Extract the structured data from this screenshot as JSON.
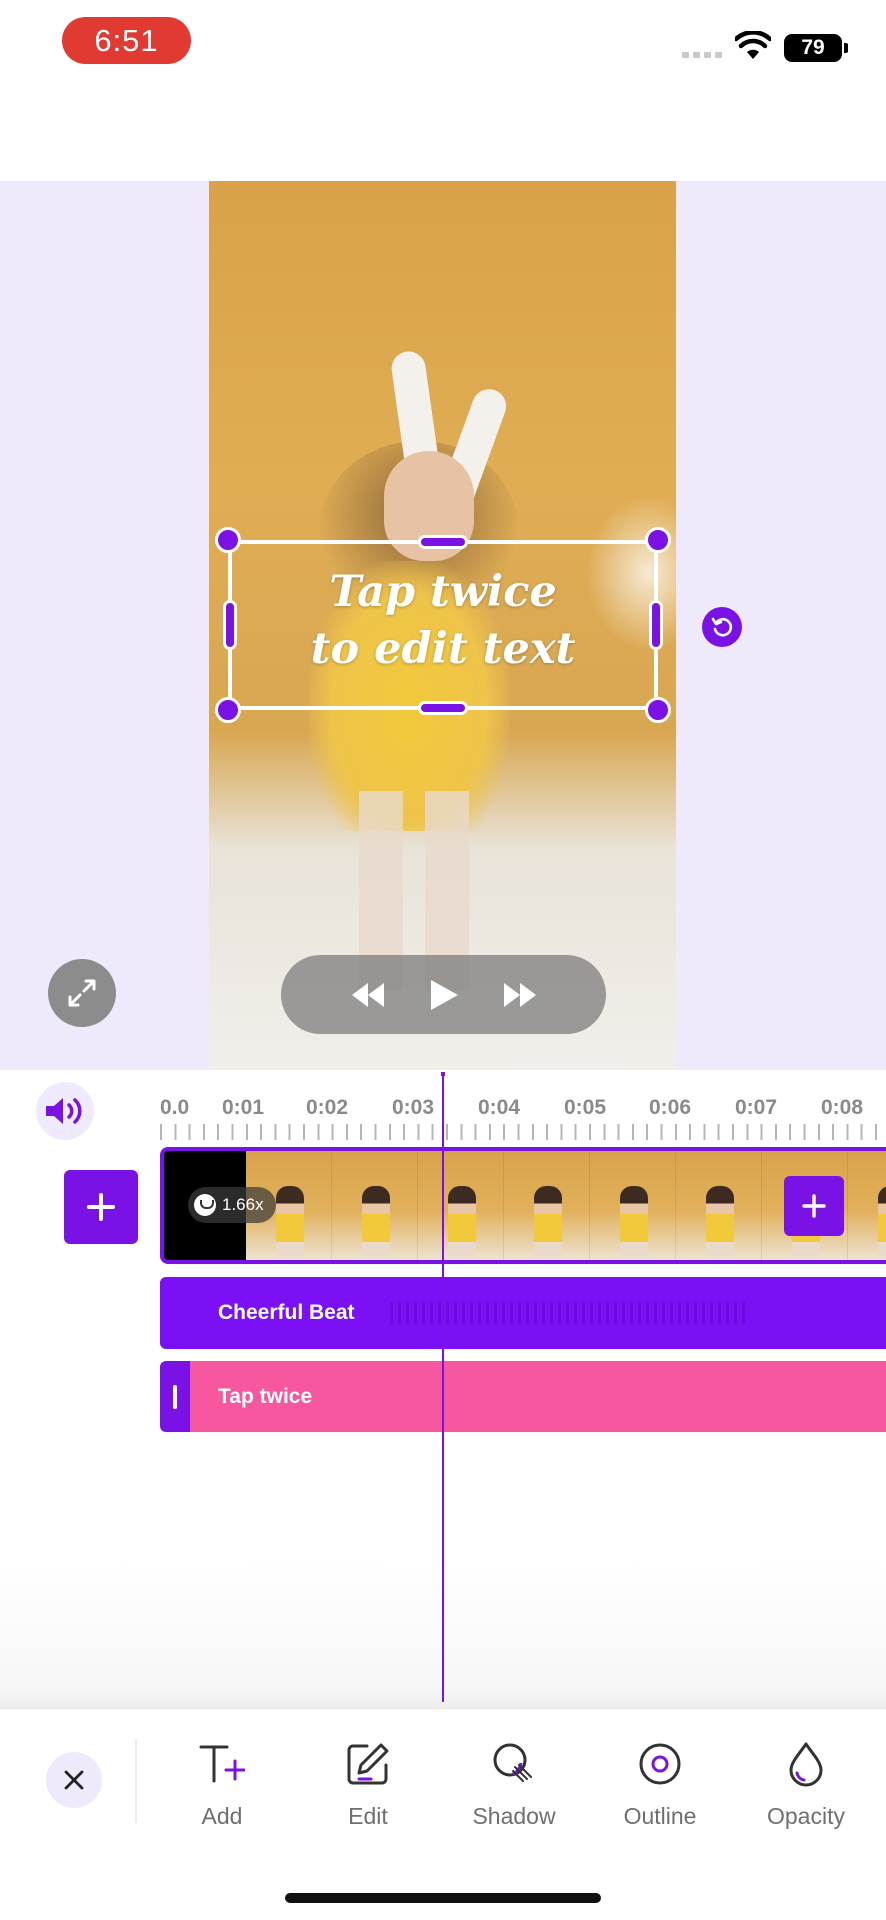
{
  "status_bar": {
    "time": "6:51",
    "battery": "79"
  },
  "preview": {
    "overlay_text_line1": "Tap twice",
    "overlay_text_line2": "to edit text"
  },
  "timeline": {
    "ruler_labels": [
      "0.0",
      "0:01",
      "0:02",
      "0:03",
      "0:04",
      "0:05",
      "0:06",
      "0:07",
      "0:08"
    ],
    "speed_badge": "1.66x",
    "audio_track_label": "Cheerful Beat",
    "text_track_label": "Tap twice"
  },
  "toolbar": {
    "items": [
      {
        "label": "Add",
        "icon": "text-add-icon"
      },
      {
        "label": "Edit",
        "icon": "edit-pencil-icon"
      },
      {
        "label": "Shadow",
        "icon": "shadow-icon"
      },
      {
        "label": "Outline",
        "icon": "outline-icon"
      },
      {
        "label": "Opacity",
        "icon": "opacity-drop-icon"
      }
    ]
  },
  "colors": {
    "accent": "#7a12e6",
    "status_time_bg": "#e03a32",
    "audio_track": "#7b0ff5",
    "text_track": "#f6579e",
    "preview_bg": "#eeeafb"
  }
}
